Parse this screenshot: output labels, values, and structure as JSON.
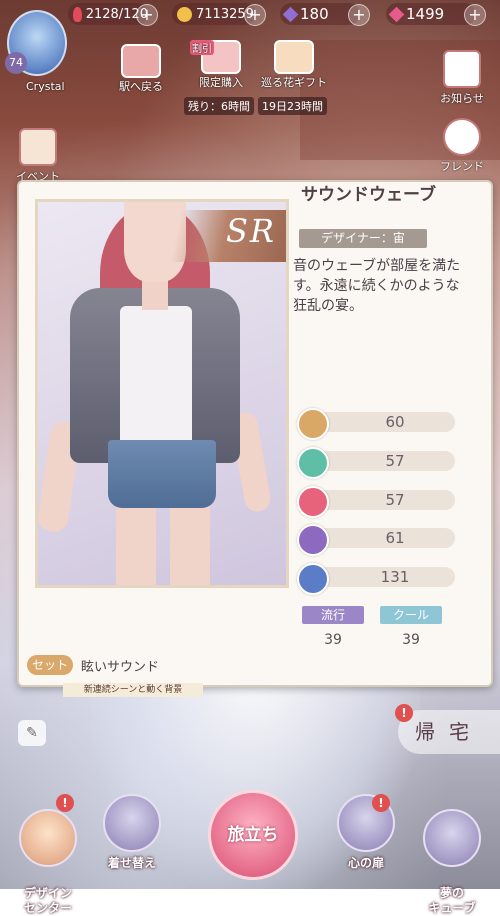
{
  "resources": {
    "stamina": "2128/120",
    "gold": "7113259",
    "diamond": "180",
    "pink_diamond": "1499"
  },
  "player": {
    "level": "74",
    "name": "Crystal"
  },
  "top_buttons": {
    "station": "駅へ戻る",
    "limited": "限定購入",
    "limited_badge": "割引",
    "limited_timer": "残り：6時間",
    "flower_gift": "巡る花ギフト",
    "flower_timer": "19日23時間"
  },
  "side_buttons": {
    "notice": "お知らせ",
    "friend": "フレンド",
    "event": "イベント"
  },
  "item": {
    "rarity": "SR",
    "name": "サウンドウェーブ",
    "designer": "デザイナー：宙",
    "description": "音のウェーブが部屋を満たす。永遠に続くかのような狂乱の宴。",
    "stats": [
      {
        "icon": "moon-icon",
        "value": "60",
        "color": "#d9a766"
      },
      {
        "icon": "sparkle-icon",
        "value": "57",
        "color": "#5fbfa6"
      },
      {
        "icon": "flower-icon",
        "value": "57",
        "color": "#e6637b"
      },
      {
        "icon": "heart-icon",
        "value": "61",
        "color": "#8d6ac0"
      },
      {
        "icon": "shield-icon",
        "value": "131",
        "color": "#5b7cc7"
      }
    ],
    "tags": [
      {
        "label": "流行",
        "value": "39",
        "color": "#9b87c7"
      },
      {
        "label": "クール",
        "value": "39",
        "color": "#8ec6d6"
      }
    ],
    "set_label": "セット",
    "set_name": "眩いサウンド"
  },
  "banner": "新連続シーンと動く背景",
  "home_button": "帰宅",
  "bottom_nav": {
    "design_center": "デザイン\nセンター",
    "dress_up": "着せ替え",
    "journey": "旅立ち",
    "heart_room": "心の扉",
    "dream_cube": "夢の\nキューブ"
  }
}
